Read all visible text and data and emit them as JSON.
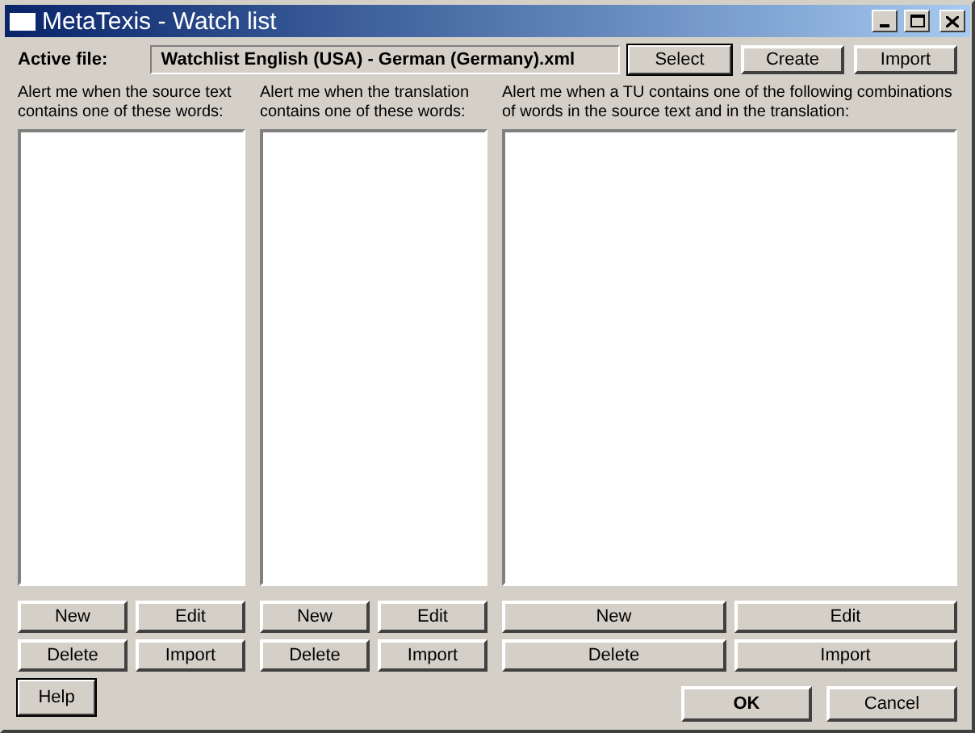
{
  "window": {
    "title": "MetaTexis - Watch list"
  },
  "active_file": {
    "label": "Active file:",
    "value": "Watchlist English (USA) - German (Germany).xml"
  },
  "file_buttons": [
    {
      "label": "Select",
      "focused": true
    },
    {
      "label": "Create",
      "focused": false
    },
    {
      "label": "Import",
      "focused": false
    }
  ],
  "panels": [
    {
      "caption": "Alert me when the source text contains one of these words:",
      "buttons": [
        "New",
        "Edit",
        "Delete",
        "Import"
      ]
    },
    {
      "caption": "Alert me when the translation contains one of these words:",
      "buttons": [
        "New",
        "Edit",
        "Delete",
        "Import"
      ]
    },
    {
      "caption": "Alert me when a TU contains one of the following combinations of words in the source text and in the translation:",
      "buttons": [
        "New",
        "Edit",
        "Delete",
        "Import"
      ]
    }
  ],
  "help_button": {
    "label": "Help",
    "focused": true
  },
  "dialog_buttons": [
    {
      "label": "OK",
      "default": true
    },
    {
      "label": "Cancel",
      "default": false
    }
  ]
}
